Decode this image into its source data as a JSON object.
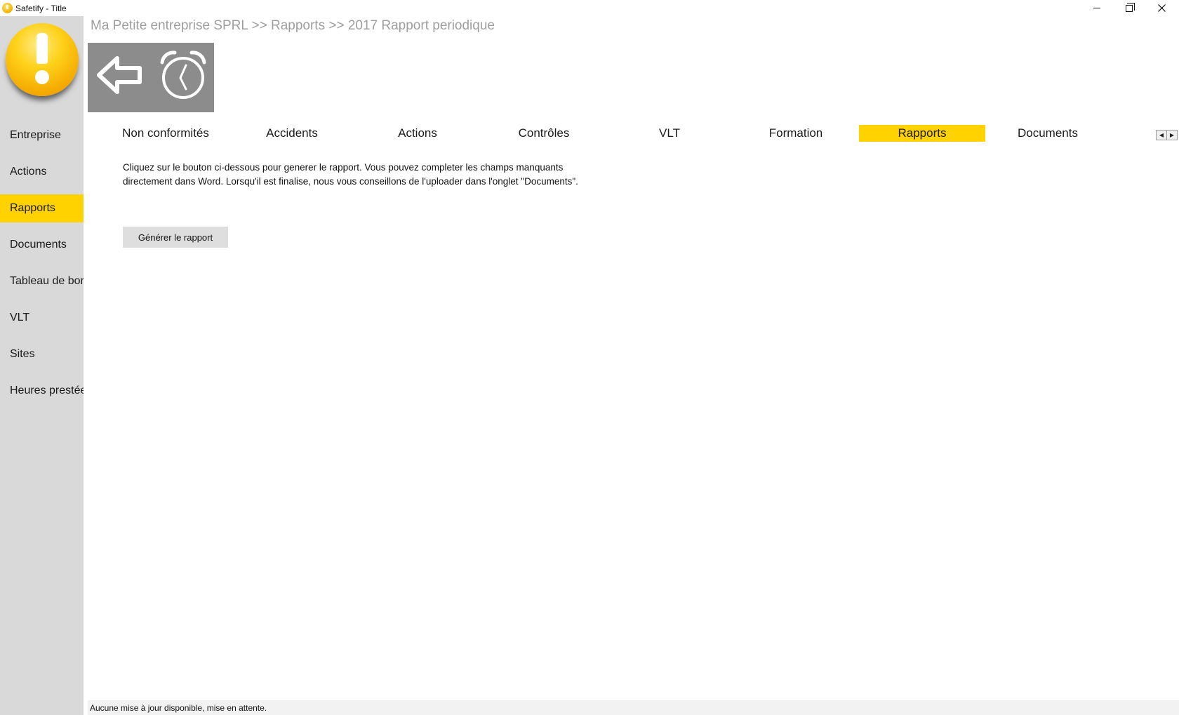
{
  "window": {
    "title": "Safetify - Title",
    "controls": {
      "minimize": "minimize",
      "maximize": "restore",
      "close": "close"
    }
  },
  "sidebar": {
    "logo_icon": "exclamation-logo",
    "active_index": 2,
    "items": [
      {
        "label": "Entreprise"
      },
      {
        "label": "Actions"
      },
      {
        "label": "Rapports"
      },
      {
        "label": "Documents"
      },
      {
        "label": "Tableau de bord"
      },
      {
        "label": "VLT"
      },
      {
        "label": "Sites"
      },
      {
        "label": "Heures prestées"
      }
    ]
  },
  "breadcrumb": "Ma Petite entreprise SPRL >> Rapports >> 2017 Rapport periodique",
  "toolbar": {
    "back_icon": "back-arrow-icon",
    "clock_icon": "alarm-clock-icon"
  },
  "tabs": {
    "active_index": 6,
    "items": [
      {
        "label": "Non conformités"
      },
      {
        "label": "Accidents"
      },
      {
        "label": "Actions"
      },
      {
        "label": "Contrôles"
      },
      {
        "label": "VLT"
      },
      {
        "label": "Formation"
      },
      {
        "label": "Rapports"
      },
      {
        "label": "Documents"
      }
    ]
  },
  "main": {
    "instructions_line1": "Cliquez sur le bouton ci-dessous pour generer le rapport. Vous pouvez completer les champs manquants",
    "instructions_line2": "directement dans Word. Lorsqu'il est finalise, nous vous conseillons de l'uploader dans l'onglet \"Documents\".",
    "generate_button_label": "Générer le rapport"
  },
  "statusbar": {
    "text": "Aucune mise à jour disponible, mise en attente."
  },
  "colors": {
    "accent": "#ffd200",
    "sidebar_bg": "#d9d9d9",
    "toolbar_bg": "#8c8c8c",
    "breadcrumb": "#9e9e9e"
  }
}
